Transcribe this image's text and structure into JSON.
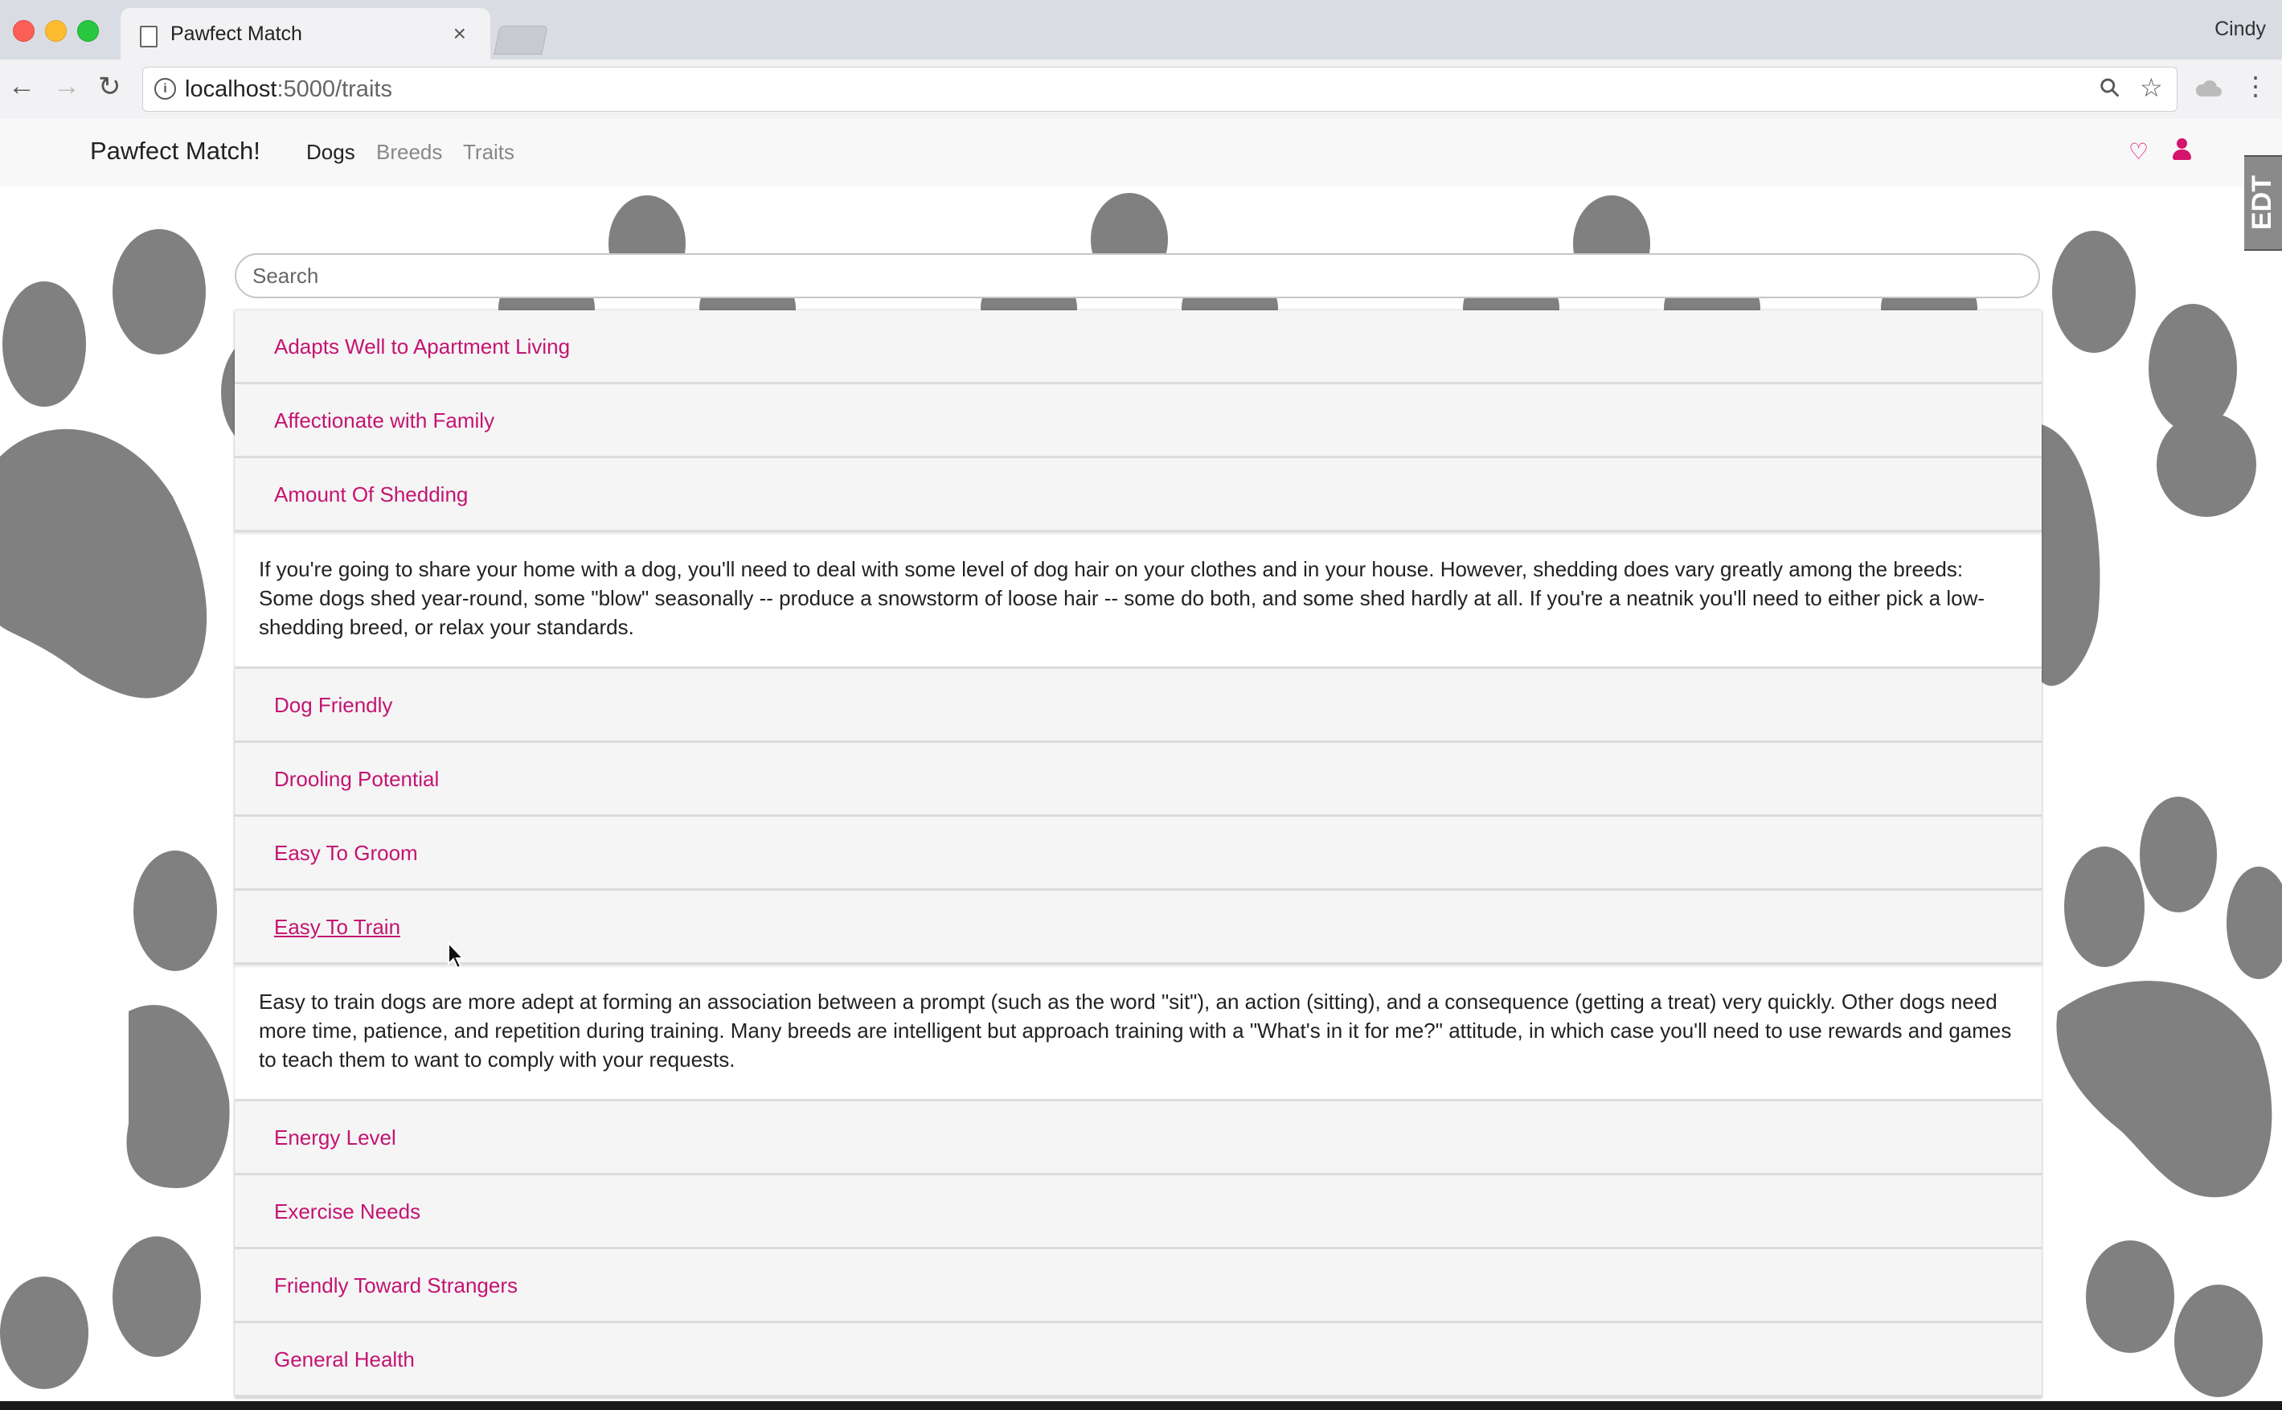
{
  "browser": {
    "tab_title": "Pawfect Match",
    "tab_close": "×",
    "profile_name": "Cindy",
    "url_host": "localhost",
    "url_path": ":5000/traits",
    "info_glyph": "i",
    "back_glyph": "←",
    "forward_glyph": "→",
    "reload_glyph": "↻",
    "zoom_glyph": "⚲",
    "star_glyph": "☆",
    "menu_glyph": "⋮"
  },
  "navbar": {
    "brand": "Pawfect Match!",
    "links": [
      "Dogs",
      "Breeds",
      "Traits"
    ],
    "favorites_icon": "heart-icon",
    "heart_glyph": "♡",
    "user_icon": "user-icon",
    "extension_badge": "EDT"
  },
  "search": {
    "placeholder": "Search"
  },
  "traits": [
    {
      "label": "Adapts Well to Apartment Living"
    },
    {
      "label": "Affectionate with Family"
    },
    {
      "label": "Amount Of Shedding",
      "description": "If you're going to share your home with a dog, you'll need to deal with some level of dog hair on your clothes and in your house. However, shedding does vary greatly among the breeds: Some dogs shed year-round, some \"blow\" seasonally -- produce a snowstorm of loose hair -- some do both, and some shed hardly at all. If you're a neatnik you'll need to either pick a low-shedding breed, or relax your standards."
    },
    {
      "label": "Dog Friendly"
    },
    {
      "label": "Drooling Potential"
    },
    {
      "label": "Easy To Groom"
    },
    {
      "label": "Easy To Train",
      "description": "Easy to train dogs are more adept at forming an association between a prompt (such as the word \"sit\"), an action (sitting), and a consequence (getting a treat) very quickly. Other dogs need more time, patience, and repetition during training. Many breeds are intelligent but approach training with a \"What's in it for me?\" attitude, in which case you'll need to use rewards and games to teach them to want to comply with your requests."
    },
    {
      "label": "Energy Level"
    },
    {
      "label": "Exercise Needs"
    },
    {
      "label": "Friendly Toward Strangers"
    },
    {
      "label": "General Health"
    }
  ],
  "colors": {
    "accent": "#c41472",
    "icon_pink": "#d6136d",
    "paw": "#808080",
    "row_bg": "#f5f5f5"
  }
}
